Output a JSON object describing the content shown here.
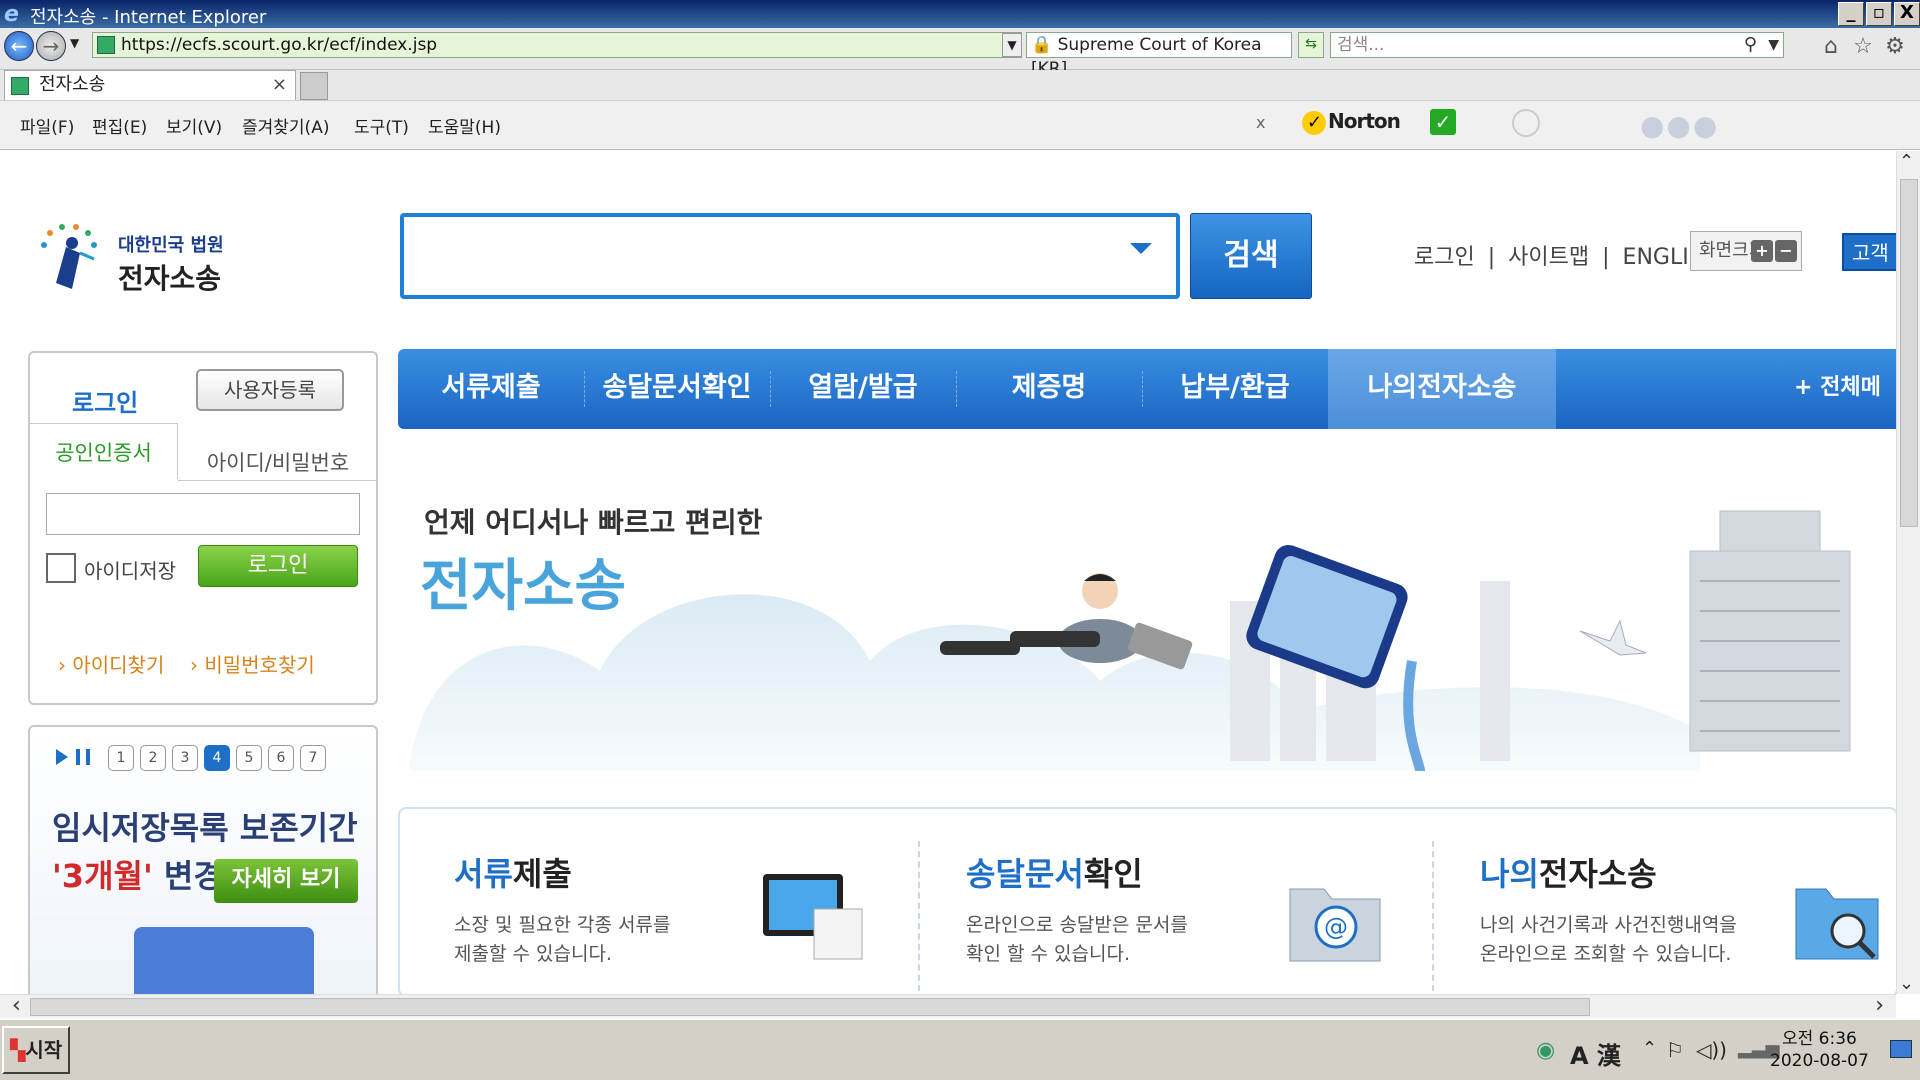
{
  "window": {
    "title": "전자소송 - Internet Explorer",
    "controls": [
      "_",
      "▫",
      "X"
    ]
  },
  "address": {
    "url": "https://ecfs.scourt.go.kr/ecf/index.jsp",
    "cert": "Supreme Court of Korea [KR]",
    "search_placeholder": "검색..."
  },
  "tab": {
    "label": "전자소송",
    "close": "×"
  },
  "menu": {
    "items": [
      "파일(F)",
      "편집(E)",
      "보기(V)",
      "즐겨찾기(A)",
      "도구(T)",
      "도움말(H)"
    ],
    "norton_close": "x",
    "norton": "Norton"
  },
  "header": {
    "logo_top": "대한민국 법원",
    "logo_main": "전자소송",
    "search_button": "검색",
    "links": [
      "로그인",
      "|",
      "사이트맵",
      "|",
      "ENGLISH"
    ],
    "zoom_label": "화면크기",
    "zoom_plus": "+",
    "zoom_minus": "−",
    "customer": "고객지"
  },
  "login": {
    "title": "로그인",
    "signup": "사용자등록",
    "tab_cert": "공인인증서",
    "tab_id": "아이디/비밀번호",
    "save_id": "아이디저장",
    "login_button": "로그인",
    "find_id": "› 아이디찾기",
    "find_pw": "› 비밀번호찾기"
  },
  "notice": {
    "pages": [
      "1",
      "2",
      "3",
      "4",
      "5",
      "6",
      "7"
    ],
    "active_page": "4",
    "title": "임시저장목록 보존기간",
    "highlight": "'3개월'",
    "suffix": " 변경",
    "more": "자세히 보기"
  },
  "nav": {
    "items": [
      "서류제출",
      "송달문서확인",
      "열람/발급",
      "제증명",
      "납부/환급",
      "나의전자소송"
    ],
    "active": "나의전자소송",
    "all_menu": "+ 전체메뉴"
  },
  "hero": {
    "sub": "언제 어디서나 빠르고 편리한",
    "main": "전자소송"
  },
  "cards": [
    {
      "title_blue": "서류",
      "title_rest": "제출",
      "desc1": "소장 및 필요한 각종 서류를",
      "desc2": "제출할 수 있습니다."
    },
    {
      "title_blue": "송달문서",
      "title_rest": "확인",
      "desc1": "온라인으로 송달받은 문서를",
      "desc2": "확인 할 수 있습니다."
    },
    {
      "title_blue": "나의",
      "title_rest": "전자소송",
      "desc1": "나의 사건기록과 사건진행내역을",
      "desc2": "온라인으로 조회할 수 있습니다."
    }
  ],
  "taskbar": {
    "start": "시작",
    "ime": "A 漢",
    "time": "오전 6:36",
    "date": "2020-08-07"
  }
}
